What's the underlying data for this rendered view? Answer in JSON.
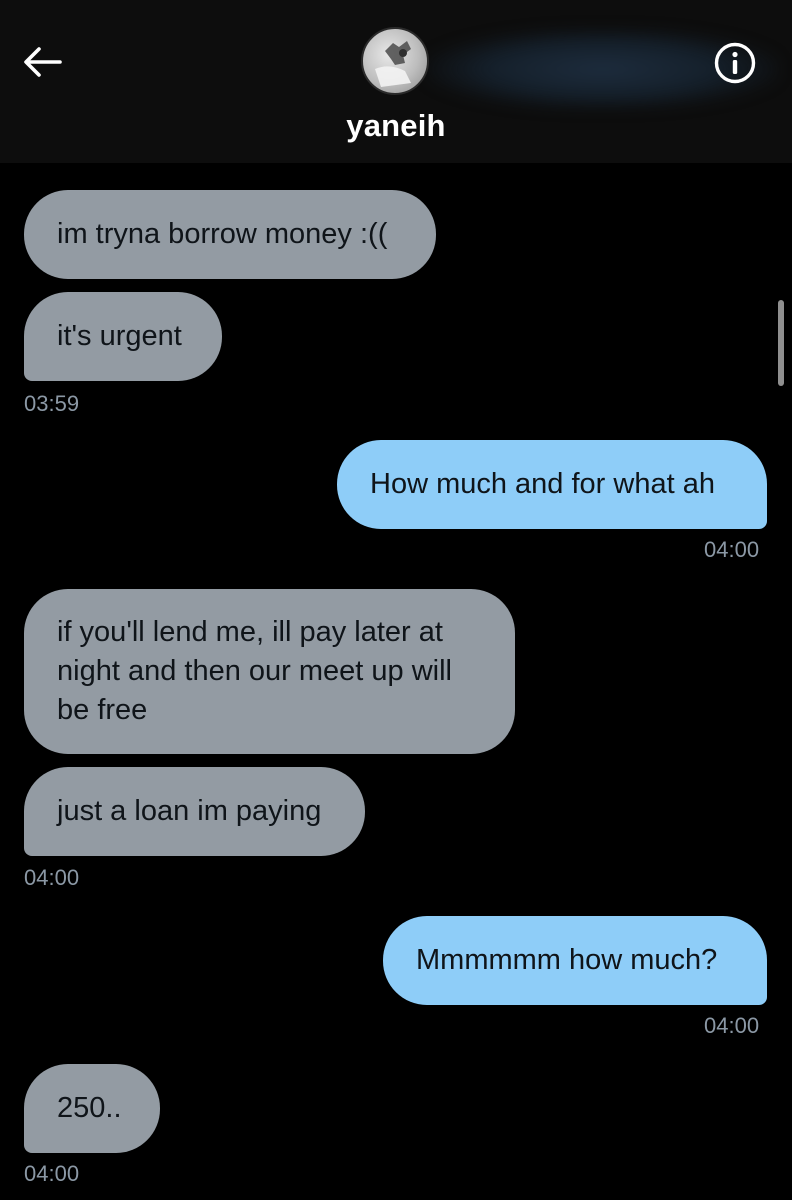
{
  "header": {
    "username": "yaneih"
  },
  "messages": [
    {
      "side": "in",
      "text": "im tryna borrow money :(("
    },
    {
      "side": "in",
      "text": "it's urgent"
    },
    {
      "side": "out",
      "text": "How much and for what ah"
    },
    {
      "side": "in",
      "text": "if you'll lend me, ill pay later at night and then our meet up will be free"
    },
    {
      "side": "in",
      "text": "just a loan im paying"
    },
    {
      "side": "out",
      "text": "Mmmmmm how much?"
    },
    {
      "side": "in",
      "text": "250.."
    }
  ],
  "timestamps": [
    "03:59",
    "04:00",
    "04:00",
    "04:00",
    "04:00"
  ],
  "colors": {
    "incoming_bubble": "#939ba3",
    "outgoing_bubble": "#8ecdf8",
    "timestamp": "#8b98a5",
    "background": "#000000"
  },
  "icons": {
    "back": "arrow-left-icon",
    "info": "info-circle-icon"
  }
}
